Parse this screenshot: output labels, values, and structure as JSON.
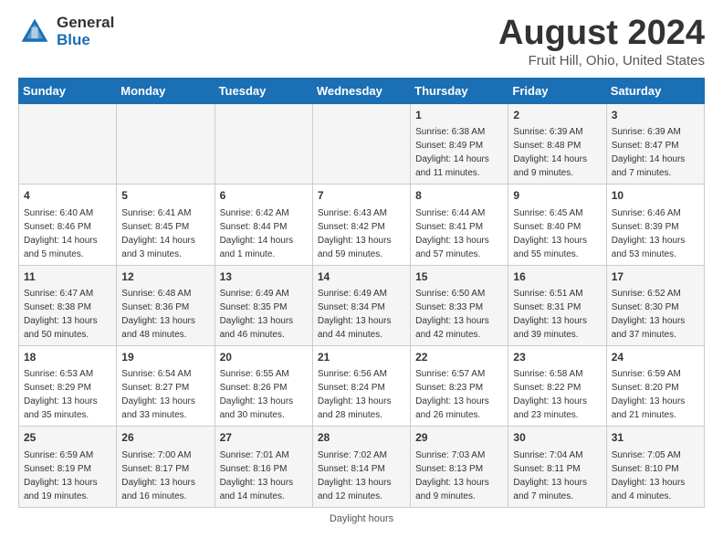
{
  "logo": {
    "general": "General",
    "blue": "Blue"
  },
  "title": "August 2024",
  "subtitle": "Fruit Hill, Ohio, United States",
  "days_of_week": [
    "Sunday",
    "Monday",
    "Tuesday",
    "Wednesday",
    "Thursday",
    "Friday",
    "Saturday"
  ],
  "footer": "Daylight hours",
  "weeks": [
    [
      {
        "day": "",
        "info": ""
      },
      {
        "day": "",
        "info": ""
      },
      {
        "day": "",
        "info": ""
      },
      {
        "day": "",
        "info": ""
      },
      {
        "day": "1",
        "info": "Sunrise: 6:38 AM\nSunset: 8:49 PM\nDaylight: 14 hours and 11 minutes."
      },
      {
        "day": "2",
        "info": "Sunrise: 6:39 AM\nSunset: 8:48 PM\nDaylight: 14 hours and 9 minutes."
      },
      {
        "day": "3",
        "info": "Sunrise: 6:39 AM\nSunset: 8:47 PM\nDaylight: 14 hours and 7 minutes."
      }
    ],
    [
      {
        "day": "4",
        "info": "Sunrise: 6:40 AM\nSunset: 8:46 PM\nDaylight: 14 hours and 5 minutes."
      },
      {
        "day": "5",
        "info": "Sunrise: 6:41 AM\nSunset: 8:45 PM\nDaylight: 14 hours and 3 minutes."
      },
      {
        "day": "6",
        "info": "Sunrise: 6:42 AM\nSunset: 8:44 PM\nDaylight: 14 hours and 1 minute."
      },
      {
        "day": "7",
        "info": "Sunrise: 6:43 AM\nSunset: 8:42 PM\nDaylight: 13 hours and 59 minutes."
      },
      {
        "day": "8",
        "info": "Sunrise: 6:44 AM\nSunset: 8:41 PM\nDaylight: 13 hours and 57 minutes."
      },
      {
        "day": "9",
        "info": "Sunrise: 6:45 AM\nSunset: 8:40 PM\nDaylight: 13 hours and 55 minutes."
      },
      {
        "day": "10",
        "info": "Sunrise: 6:46 AM\nSunset: 8:39 PM\nDaylight: 13 hours and 53 minutes."
      }
    ],
    [
      {
        "day": "11",
        "info": "Sunrise: 6:47 AM\nSunset: 8:38 PM\nDaylight: 13 hours and 50 minutes."
      },
      {
        "day": "12",
        "info": "Sunrise: 6:48 AM\nSunset: 8:36 PM\nDaylight: 13 hours and 48 minutes."
      },
      {
        "day": "13",
        "info": "Sunrise: 6:49 AM\nSunset: 8:35 PM\nDaylight: 13 hours and 46 minutes."
      },
      {
        "day": "14",
        "info": "Sunrise: 6:49 AM\nSunset: 8:34 PM\nDaylight: 13 hours and 44 minutes."
      },
      {
        "day": "15",
        "info": "Sunrise: 6:50 AM\nSunset: 8:33 PM\nDaylight: 13 hours and 42 minutes."
      },
      {
        "day": "16",
        "info": "Sunrise: 6:51 AM\nSunset: 8:31 PM\nDaylight: 13 hours and 39 minutes."
      },
      {
        "day": "17",
        "info": "Sunrise: 6:52 AM\nSunset: 8:30 PM\nDaylight: 13 hours and 37 minutes."
      }
    ],
    [
      {
        "day": "18",
        "info": "Sunrise: 6:53 AM\nSunset: 8:29 PM\nDaylight: 13 hours and 35 minutes."
      },
      {
        "day": "19",
        "info": "Sunrise: 6:54 AM\nSunset: 8:27 PM\nDaylight: 13 hours and 33 minutes."
      },
      {
        "day": "20",
        "info": "Sunrise: 6:55 AM\nSunset: 8:26 PM\nDaylight: 13 hours and 30 minutes."
      },
      {
        "day": "21",
        "info": "Sunrise: 6:56 AM\nSunset: 8:24 PM\nDaylight: 13 hours and 28 minutes."
      },
      {
        "day": "22",
        "info": "Sunrise: 6:57 AM\nSunset: 8:23 PM\nDaylight: 13 hours and 26 minutes."
      },
      {
        "day": "23",
        "info": "Sunrise: 6:58 AM\nSunset: 8:22 PM\nDaylight: 13 hours and 23 minutes."
      },
      {
        "day": "24",
        "info": "Sunrise: 6:59 AM\nSunset: 8:20 PM\nDaylight: 13 hours and 21 minutes."
      }
    ],
    [
      {
        "day": "25",
        "info": "Sunrise: 6:59 AM\nSunset: 8:19 PM\nDaylight: 13 hours and 19 minutes."
      },
      {
        "day": "26",
        "info": "Sunrise: 7:00 AM\nSunset: 8:17 PM\nDaylight: 13 hours and 16 minutes."
      },
      {
        "day": "27",
        "info": "Sunrise: 7:01 AM\nSunset: 8:16 PM\nDaylight: 13 hours and 14 minutes."
      },
      {
        "day": "28",
        "info": "Sunrise: 7:02 AM\nSunset: 8:14 PM\nDaylight: 13 hours and 12 minutes."
      },
      {
        "day": "29",
        "info": "Sunrise: 7:03 AM\nSunset: 8:13 PM\nDaylight: 13 hours and 9 minutes."
      },
      {
        "day": "30",
        "info": "Sunrise: 7:04 AM\nSunset: 8:11 PM\nDaylight: 13 hours and 7 minutes."
      },
      {
        "day": "31",
        "info": "Sunrise: 7:05 AM\nSunset: 8:10 PM\nDaylight: 13 hours and 4 minutes."
      }
    ]
  ]
}
